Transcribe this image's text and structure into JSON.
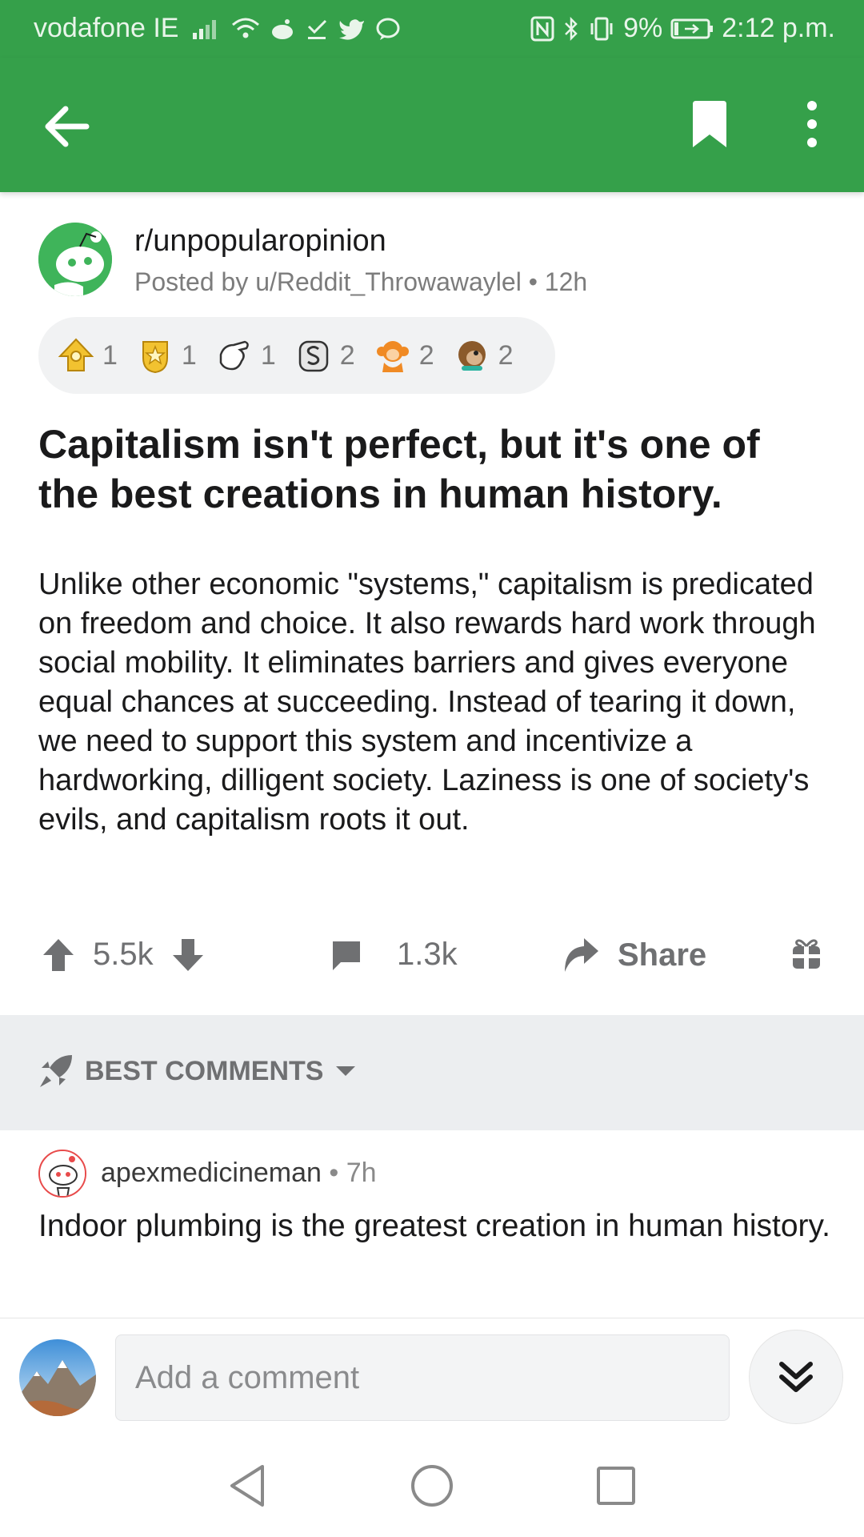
{
  "status_bar": {
    "carrier": "vodafone IE",
    "battery": "9%",
    "time": "2:12 p.m."
  },
  "app_bar": {
    "back_icon": "arrow-left-icon",
    "bookmark_icon": "bookmark-icon",
    "more_icon": "more-vertical-icon"
  },
  "post": {
    "subreddit": "r/unpopularopinion",
    "posted_by": "Posted by u/Reddit_Throwawaylel • 12h",
    "awards": [
      {
        "icon": "award-gold-icon",
        "count": "1"
      },
      {
        "icon": "award-star-icon",
        "count": "1"
      },
      {
        "icon": "award-hand-icon",
        "count": "1"
      },
      {
        "icon": "award-coin-icon",
        "count": "2"
      },
      {
        "icon": "award-monkey-icon",
        "count": "2"
      },
      {
        "icon": "award-chimp-icon",
        "count": "2"
      }
    ],
    "title": "Capitalism isn't perfect, but it's one of the best creations in human history.",
    "body": "Unlike other economic \"systems,\" capitalism is predicated on freedom and choice. It also rewards hard work through social mobility. It eliminates barriers and gives everyone equal chances at succeeding. Instead of tearing it down, we need to support this system and incentivize a hardworking, dilligent society. Laziness is one of society's evils, and capitalism roots it out."
  },
  "actions": {
    "score": "5.5k",
    "comments": "1.3k",
    "share": "Share"
  },
  "comments_section": {
    "sort_label": "BEST COMMENTS"
  },
  "comment": {
    "author": "apexmedicineman",
    "age": " • 7h",
    "text": "Indoor plumbing is the greatest creation in human history."
  },
  "composer": {
    "placeholder": "Add a comment"
  },
  "colors": {
    "brand_green": "#35a04a",
    "icon_gray": "#6f7072"
  }
}
